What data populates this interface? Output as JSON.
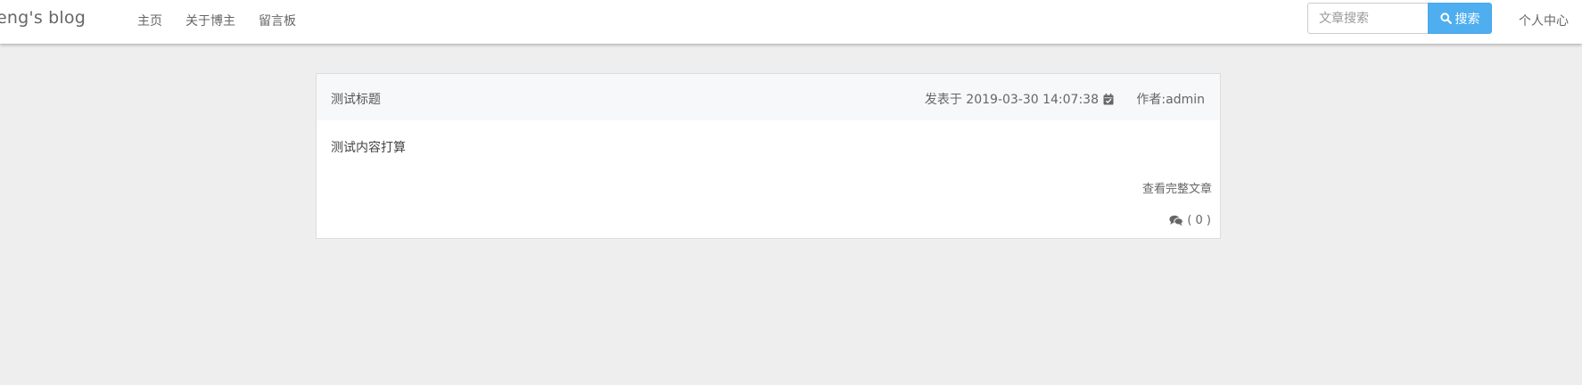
{
  "header": {
    "brand": "eng's blog",
    "nav": [
      {
        "label": "主页"
      },
      {
        "label": "关于博主"
      },
      {
        "label": "留言板"
      }
    ],
    "search": {
      "placeholder": "文章搜索",
      "value": "",
      "button_label": "搜索",
      "button_icon": "search-icon"
    },
    "user_center": "个人中心"
  },
  "article": {
    "title": "测试标题",
    "date_text": "发表于 2019-03-30 14:07:38",
    "date_icon": "calendar-check-icon",
    "author_text": "作者:admin",
    "content": "测试内容打算",
    "read_more": "查看完整文章",
    "comments_icon": "comments-icon",
    "comments_text": "( 0 )"
  },
  "colors": {
    "page_background": "#eeeeee",
    "navbar_background": "#ffffff",
    "search_button": "#4eaef0",
    "card_header": "#f7f8f9",
    "card_border": "#dddddd",
    "text": "#666666"
  }
}
